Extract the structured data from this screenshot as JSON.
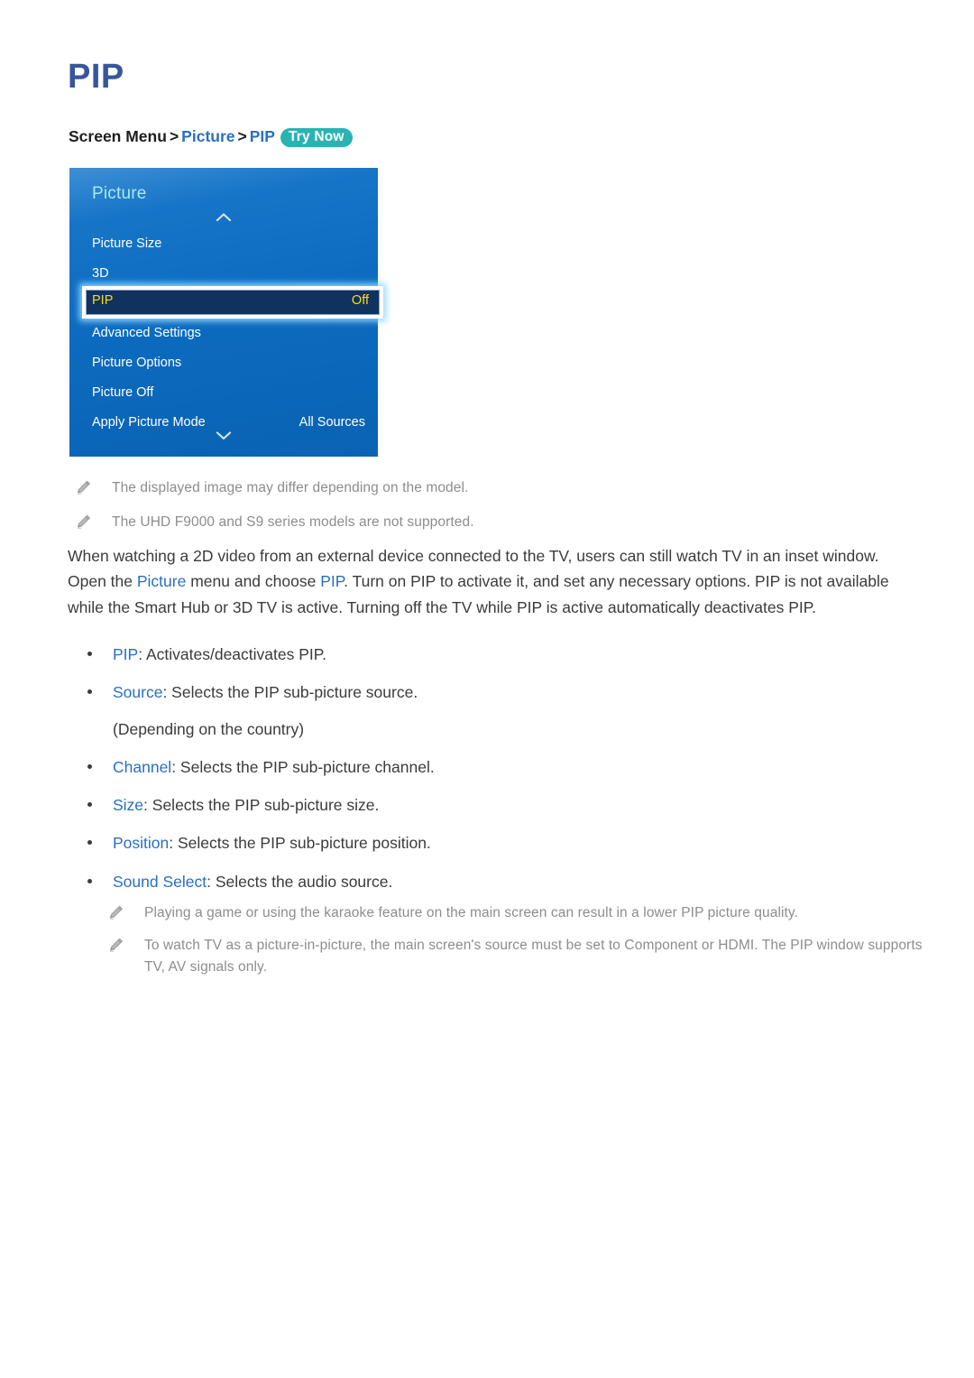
{
  "page": {
    "title": "PIP"
  },
  "breadcrumb": {
    "root": "Screen Menu",
    "sep": ">",
    "level1": "Picture",
    "level2": "PIP",
    "badge": "Try Now"
  },
  "tv_menu": {
    "panel_title": "Picture",
    "scroll_up_icon": "chevron-up-icon",
    "scroll_down_icon": "chevron-down-icon",
    "rows": [
      {
        "label": "Picture Size",
        "value": ""
      },
      {
        "label": "3D",
        "value": ""
      },
      {
        "label": "Advanced Settings",
        "value": ""
      },
      {
        "label": "Picture Options",
        "value": ""
      },
      {
        "label": "Picture Off",
        "value": ""
      },
      {
        "label": "Apply Picture Mode",
        "value": "All Sources"
      }
    ],
    "highlighted_row": {
      "label": "PIP",
      "value": "Off"
    },
    "colors": {
      "panel_blue": "#0d6cc0",
      "panel_top_blue": "#3f8fd4",
      "header_cyan": "#a9e9f2",
      "highlight_fill": "#10325e",
      "highlight_border": "#ffffff",
      "highlight_text": "#ffd919"
    }
  },
  "notes_top": [
    {
      "icon": "pencil-icon",
      "text": "The displayed image may differ depending on the model."
    },
    {
      "icon": "pencil-icon",
      "text": "The UHD F9000 and S9 series models are not supported."
    }
  ],
  "body": {
    "p1_a": "When watching a 2D video from an external device connected to the TV, users can still watch TV in an inset window. Open the ",
    "p1_hl1": "Picture",
    "p1_b": " menu and choose ",
    "p1_hl2": "PIP",
    "p1_c": ". Turn on PIP to activate it, and set any necessary options. PIP is not available while the Smart Hub or 3D TV is active. Turning off the TV while PIP is active automatically deactivates PIP."
  },
  "bullets": [
    {
      "term": "PIP",
      "desc": ": Activates/deactivates PIP.",
      "sub": ""
    },
    {
      "term": "Source",
      "desc": ": Selects the PIP sub-picture source.",
      "sub": "(Depending on the country)"
    },
    {
      "term": "Channel",
      "desc": ": Selects the PIP sub-picture channel.",
      "sub": ""
    },
    {
      "term": "Size",
      "desc": ": Selects the PIP sub-picture size.",
      "sub": ""
    },
    {
      "term": "Position",
      "desc": ": Selects the PIP sub-picture position.",
      "sub": ""
    },
    {
      "term": "Sound Select",
      "desc": ": Selects the audio source.",
      "sub": ""
    }
  ],
  "notes_bottom": [
    {
      "icon": "pencil-icon",
      "text": "Playing a game or using the karaoke feature on the main screen can result in a lower PIP picture quality."
    },
    {
      "icon": "pencil-icon",
      "text": "To watch TV as a picture-in-picture, the main screen's source must be set to Component or HDMI. The PIP window supports TV, AV signals only."
    }
  ],
  "colors": {
    "title_blue": "#37569b",
    "link_blue": "#2a6fc2",
    "badge_teal": "#2bb3b3",
    "note_gray": "#8d8d8d",
    "body_text": "#3b3b3b"
  }
}
